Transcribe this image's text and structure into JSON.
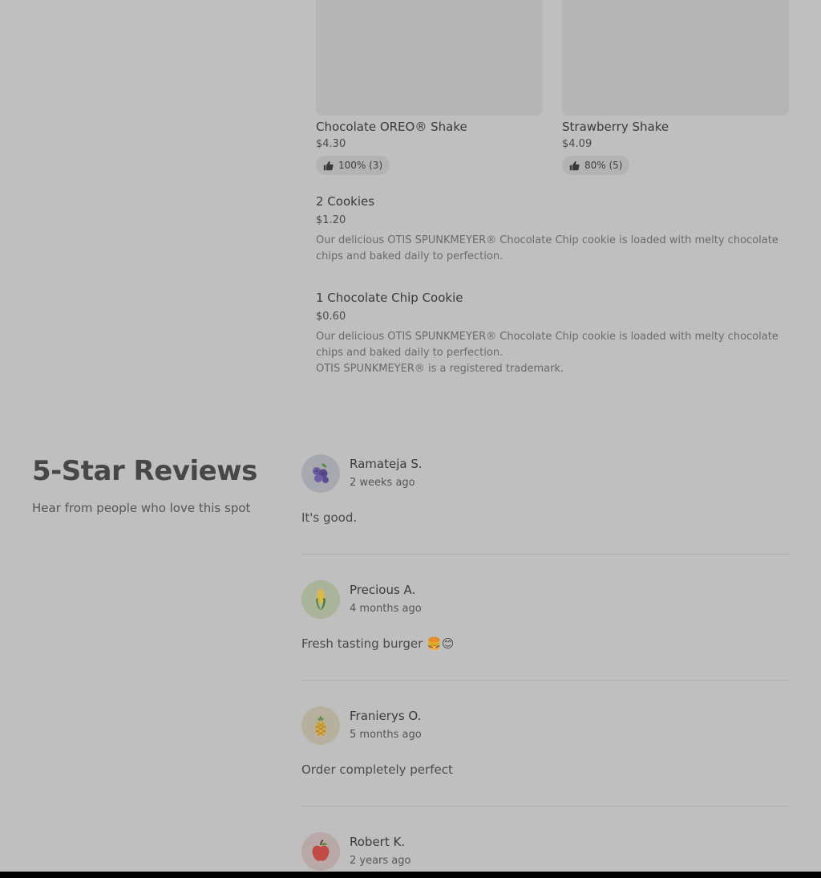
{
  "menu": {
    "cards": [
      {
        "title": "Chocolate OREO® Shake",
        "price": "$4.30",
        "rating": "100% (3)"
      },
      {
        "title": "Strawberry Shake",
        "price": "$4.09",
        "rating": "80% (5)"
      }
    ],
    "items": [
      {
        "title": "2 Cookies",
        "price": "$1.20",
        "description": "Our delicious OTIS SPUNKMEYER® Chocolate Chip cookie is loaded with melty chocolate chips and baked daily to perfection.",
        "note": ""
      },
      {
        "title": "1 Chocolate Chip Cookie",
        "price": "$0.60",
        "description": "Our delicious OTIS SPUNKMEYER® Chocolate Chip cookie is loaded with melty chocolate chips and baked daily to perfection.",
        "note": "OTIS SPUNKMEYER® is a registered trademark."
      }
    ]
  },
  "reviews": {
    "heading": "5-Star Reviews",
    "subheading": "Hear from people who love this spot",
    "list": [
      {
        "name": "Ramateja S.",
        "time": "2 weeks ago",
        "text": "It's good.",
        "avatar_icon": "blueberries-icon",
        "avatar_bg": "#a8a8b0"
      },
      {
        "name": "Precious A.",
        "time": "4 months ago",
        "text": "Fresh tasting burger 🍔😊",
        "avatar_icon": "corn-icon",
        "avatar_bg": "#aab49a"
      },
      {
        "name": "Franierys O.",
        "time": "5 months ago",
        "text": "Order completely perfect",
        "avatar_icon": "pineapple-icon",
        "avatar_bg": "#b8b09e"
      },
      {
        "name": "Robert K.",
        "time": "2 years ago",
        "text": "",
        "avatar_icon": "apple-icon",
        "avatar_bg": "#b8a8a8"
      }
    ]
  }
}
